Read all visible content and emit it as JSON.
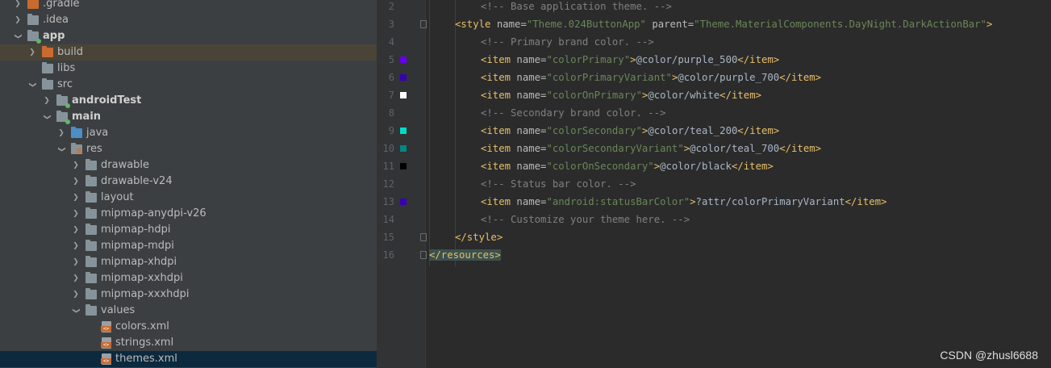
{
  "tree": {
    "rows": [
      {
        "label": ".gradle",
        "arrow": "›",
        "icon": "orange",
        "bold": false
      },
      {
        "label": ".idea",
        "arrow": "›",
        "icon": "gray",
        "bold": false
      },
      {
        "label": "app",
        "arrow": "⌄",
        "icon": "gray-module",
        "bold": true
      },
      {
        "label": "build",
        "arrow": "›",
        "icon": "orange",
        "bold": false
      },
      {
        "label": "libs",
        "arrow": "",
        "icon": "gray",
        "bold": false
      },
      {
        "label": "src",
        "arrow": "⌄",
        "icon": "gray",
        "bold": false
      },
      {
        "label": "androidTest",
        "arrow": "›",
        "icon": "gray-module",
        "bold": true
      },
      {
        "label": "main",
        "arrow": "⌄",
        "icon": "gray-module",
        "bold": true
      },
      {
        "label": "java",
        "arrow": "›",
        "icon": "blue",
        "bold": false
      },
      {
        "label": "res",
        "arrow": "⌄",
        "icon": "res",
        "bold": false
      },
      {
        "label": "drawable",
        "arrow": "›",
        "icon": "gray",
        "bold": false
      },
      {
        "label": "drawable-v24",
        "arrow": "›",
        "icon": "gray",
        "bold": false
      },
      {
        "label": "layout",
        "arrow": "›",
        "icon": "gray",
        "bold": false
      },
      {
        "label": "mipmap-anydpi-v26",
        "arrow": "›",
        "icon": "gray",
        "bold": false
      },
      {
        "label": "mipmap-hdpi",
        "arrow": "›",
        "icon": "gray",
        "bold": false
      },
      {
        "label": "mipmap-mdpi",
        "arrow": "›",
        "icon": "gray",
        "bold": false
      },
      {
        "label": "mipmap-xhdpi",
        "arrow": "›",
        "icon": "gray",
        "bold": false
      },
      {
        "label": "mipmap-xxhdpi",
        "arrow": "›",
        "icon": "gray",
        "bold": false
      },
      {
        "label": "mipmap-xxxhdpi",
        "arrow": "›",
        "icon": "gray",
        "bold": false
      },
      {
        "label": "values",
        "arrow": "⌄",
        "icon": "gray",
        "bold": false
      },
      {
        "label": "colors.xml",
        "arrow": "",
        "icon": "xml",
        "bold": false
      },
      {
        "label": "strings.xml",
        "arrow": "",
        "icon": "xml",
        "bold": false
      },
      {
        "label": "themes.xml",
        "arrow": "",
        "icon": "xml",
        "bold": false
      }
    ],
    "selected": "themes.xml"
  },
  "editor": {
    "lines": [
      {
        "num": "2",
        "swatch": null,
        "fold": false
      },
      {
        "num": "3",
        "swatch": null,
        "fold": true
      },
      {
        "num": "4",
        "swatch": null,
        "fold": false
      },
      {
        "num": "5",
        "swatch": "#6200ee",
        "fold": false
      },
      {
        "num": "6",
        "swatch": "#3700b3",
        "fold": false
      },
      {
        "num": "7",
        "swatch": "#ffffff",
        "fold": false
      },
      {
        "num": "8",
        "swatch": null,
        "fold": false
      },
      {
        "num": "9",
        "swatch": "#03dac5",
        "fold": false
      },
      {
        "num": "10",
        "swatch": "#018786",
        "fold": false
      },
      {
        "num": "11",
        "swatch": "#000000",
        "fold": false
      },
      {
        "num": "12",
        "swatch": null,
        "fold": false
      },
      {
        "num": "13",
        "swatch": "#3700b3",
        "fold": false
      },
      {
        "num": "14",
        "swatch": null,
        "fold": false
      },
      {
        "num": "15",
        "swatch": null,
        "fold": true
      },
      {
        "num": "16",
        "swatch": null,
        "fold": true
      }
    ],
    "code": [
      {
        "indent": 2,
        "parts": [
          [
            "com",
            "<!-- Base application theme. -->"
          ]
        ]
      },
      {
        "indent": 1,
        "parts": [
          [
            "tag",
            "<style "
          ],
          [
            "attr",
            "name="
          ],
          [
            "val",
            "\"Theme.024ButtonApp\" "
          ],
          [
            "attr",
            "parent="
          ],
          [
            "val",
            "\"Theme.MaterialComponents.DayNight.DarkActionBar\""
          ],
          [
            "tag",
            ">"
          ]
        ]
      },
      {
        "indent": 2,
        "parts": [
          [
            "com",
            "<!-- Primary brand color. -->"
          ]
        ]
      },
      {
        "indent": 2,
        "parts": [
          [
            "tag",
            "<item "
          ],
          [
            "attr",
            "name="
          ],
          [
            "val",
            "\"colorPrimary\""
          ],
          [
            "tag",
            ">"
          ],
          [
            "text",
            "@color/purple_500"
          ],
          [
            "tag",
            "</item>"
          ]
        ]
      },
      {
        "indent": 2,
        "parts": [
          [
            "tag",
            "<item "
          ],
          [
            "attr",
            "name="
          ],
          [
            "val",
            "\"colorPrimaryVariant\""
          ],
          [
            "tag",
            ">"
          ],
          [
            "text",
            "@color/purple_700"
          ],
          [
            "tag",
            "</item>"
          ]
        ]
      },
      {
        "indent": 2,
        "parts": [
          [
            "tag",
            "<item "
          ],
          [
            "attr",
            "name="
          ],
          [
            "val",
            "\"colorOnPrimary\""
          ],
          [
            "tag",
            ">"
          ],
          [
            "text",
            "@color/white"
          ],
          [
            "tag",
            "</item>"
          ]
        ]
      },
      {
        "indent": 2,
        "parts": [
          [
            "com",
            "<!-- Secondary brand color. -->"
          ]
        ]
      },
      {
        "indent": 2,
        "parts": [
          [
            "tag",
            "<item "
          ],
          [
            "attr",
            "name="
          ],
          [
            "val",
            "\"colorSecondary\""
          ],
          [
            "tag",
            ">"
          ],
          [
            "text",
            "@color/teal_200"
          ],
          [
            "tag",
            "</item>"
          ]
        ]
      },
      {
        "indent": 2,
        "parts": [
          [
            "tag",
            "<item "
          ],
          [
            "attr",
            "name="
          ],
          [
            "val",
            "\"colorSecondaryVariant\""
          ],
          [
            "tag",
            ">"
          ],
          [
            "text",
            "@color/teal_700"
          ],
          [
            "tag",
            "</item>"
          ]
        ]
      },
      {
        "indent": 2,
        "parts": [
          [
            "tag",
            "<item "
          ],
          [
            "attr",
            "name="
          ],
          [
            "val",
            "\"colorOnSecondary\""
          ],
          [
            "tag",
            ">"
          ],
          [
            "text",
            "@color/black"
          ],
          [
            "tag",
            "</item>"
          ]
        ]
      },
      {
        "indent": 2,
        "parts": [
          [
            "com",
            "<!-- Status bar color. -->"
          ]
        ]
      },
      {
        "indent": 2,
        "parts": [
          [
            "tag",
            "<item "
          ],
          [
            "attr",
            "name="
          ],
          [
            "val",
            "\"android:statusBarColor\""
          ],
          [
            "tag",
            ">"
          ],
          [
            "text",
            "?attr/colorPrimaryVariant"
          ],
          [
            "tag",
            "</item>"
          ]
        ]
      },
      {
        "indent": 2,
        "parts": [
          [
            "com",
            "<!-- Customize your theme here. -->"
          ]
        ]
      },
      {
        "indent": 1,
        "parts": [
          [
            "tag",
            "</style>"
          ]
        ]
      },
      {
        "indent": 0,
        "parts": [
          [
            "taghl",
            "</resources>"
          ]
        ]
      }
    ]
  },
  "watermark": "CSDN @zhusl6688"
}
